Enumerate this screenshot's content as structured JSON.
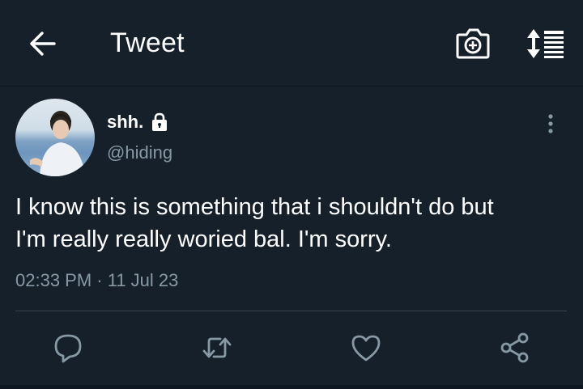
{
  "header": {
    "title": "Tweet"
  },
  "tweet": {
    "display_name": "shh.",
    "handle": "@hiding",
    "text": "I know this is something that i shouldn't do but\nI'm really really woried bal. I'm sorry.",
    "timestamp": "02:33 PM · 11 Jul 23",
    "protected": true
  },
  "icons": {
    "back": "arrow-left-icon",
    "camera": "camera-add-icon",
    "sort": "sort-icon",
    "lock": "lock-icon",
    "more": "more-vertical-icon",
    "reply": "reply-icon",
    "retweet": "retweet-icon",
    "like": "heart-icon",
    "share": "share-icon"
  },
  "colors": {
    "background": "#15202b",
    "secondary_text": "#8899a6",
    "divider": "#38444d"
  }
}
